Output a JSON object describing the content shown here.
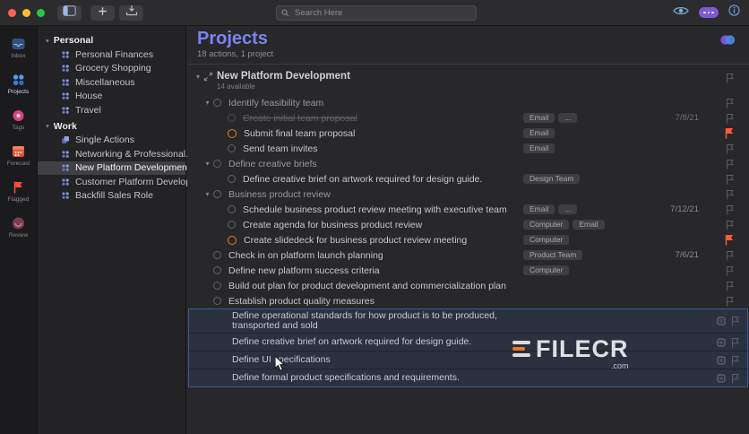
{
  "toolbar": {
    "search_placeholder": "Search Here"
  },
  "rail": {
    "items": [
      {
        "id": "inbox",
        "label": "Inbox",
        "selected": false
      },
      {
        "id": "projects",
        "label": "Projects",
        "selected": true
      },
      {
        "id": "tags",
        "label": "Tags",
        "selected": false
      },
      {
        "id": "forecast",
        "label": "Forecast",
        "selected": false
      },
      {
        "id": "flagged",
        "label": "Flagged",
        "selected": false
      },
      {
        "id": "review",
        "label": "Review",
        "selected": false
      }
    ]
  },
  "sidebar": {
    "sections": [
      {
        "title": "Personal",
        "items": [
          {
            "label": "Personal Finances"
          },
          {
            "label": "Grocery Shopping"
          },
          {
            "label": "Miscellaneous"
          },
          {
            "label": "House"
          },
          {
            "label": "Travel"
          }
        ]
      },
      {
        "title": "Work",
        "items": [
          {
            "label": "Single Actions",
            "icon": "stack"
          },
          {
            "label": "Networking & Professional..."
          },
          {
            "label": "New Platform Development",
            "selected": true
          },
          {
            "label": "Customer Platform Develop..."
          },
          {
            "label": "Backfill Sales Role"
          }
        ]
      }
    ]
  },
  "main": {
    "title": "Projects",
    "subtitle": "18 actions, 1 project",
    "project": {
      "name": "New Platform Development",
      "available": "14 available"
    },
    "overflow_label": "...",
    "tasks": [
      {
        "type": "group",
        "indent": 1,
        "title": "Identify feasibility team",
        "tags": [],
        "date": "",
        "flag": "dim"
      },
      {
        "type": "task",
        "indent": 2,
        "state": "done",
        "title": "Create initial team proposal",
        "tags": [
          "Email"
        ],
        "more": true,
        "date": "7/8/21",
        "flag": "dim"
      },
      {
        "type": "task",
        "indent": 2,
        "state": "due",
        "title": "Submit final team proposal",
        "tags": [
          "Email"
        ],
        "date": "",
        "flag": "orange"
      },
      {
        "type": "task",
        "indent": 2,
        "title": "Send team invites",
        "tags": [
          "Email"
        ],
        "date": "",
        "flag": "dim"
      },
      {
        "type": "group",
        "indent": 1,
        "title": "Define creative briefs",
        "tags": [],
        "date": "",
        "flag": "dim"
      },
      {
        "type": "task",
        "indent": 2,
        "title": "Define creative brief on artwork required for design guide.",
        "tags": [
          "Design Team"
        ],
        "date": "",
        "flag": "dim"
      },
      {
        "type": "group",
        "indent": 1,
        "title": "Business product review",
        "tags": [],
        "date": "",
        "flag": "dim"
      },
      {
        "type": "task",
        "indent": 2,
        "title": "Schedule business product review meeting with executive team",
        "tags": [
          "Email"
        ],
        "more": true,
        "date": "7/12/21",
        "flag": "dim"
      },
      {
        "type": "task",
        "indent": 2,
        "title": "Create agenda for business product review",
        "tags": [
          "Computer",
          "Email"
        ],
        "date": "",
        "flag": "dim"
      },
      {
        "type": "task",
        "indent": 2,
        "state": "due",
        "title": "Create slidedeck for business product review meeting",
        "tags": [
          "Computer"
        ],
        "date": "",
        "flag": "orange"
      },
      {
        "type": "task",
        "indent": 1,
        "title": "Check in on platform launch planning",
        "tags": [
          "Product Team"
        ],
        "date": "7/6/21",
        "flag": "dim"
      },
      {
        "type": "task",
        "indent": 1,
        "title": "Define new platform success criteria",
        "tags": [
          "Computer"
        ],
        "date": "",
        "flag": "dim"
      },
      {
        "type": "task",
        "indent": 1,
        "title": "Build out plan for product development and commercialization plan",
        "tags": [],
        "date": "",
        "flag": "dim"
      },
      {
        "type": "task",
        "indent": 1,
        "title": "Establish product quality measures",
        "tags": [],
        "date": "",
        "flag": "dim"
      },
      {
        "type": "task",
        "indent": 1,
        "selected": true,
        "handle": true,
        "title": "Define operational standards for how product is to be produced, transported and sold",
        "tags": [],
        "date": "",
        "flag": "dim"
      },
      {
        "type": "task",
        "indent": 1,
        "selected": true,
        "handle": true,
        "title": "Define creative brief on artwork required for design guide.",
        "tags": [],
        "date": "",
        "flag": "dim"
      },
      {
        "type": "task",
        "indent": 1,
        "selected": true,
        "handle": true,
        "title": "Define UI specifications",
        "tags": [],
        "date": "",
        "flag": "dim"
      },
      {
        "type": "task",
        "indent": 1,
        "selected": true,
        "handle": true,
        "title": "Define formal product specifications and requirements.",
        "tags": [],
        "date": "",
        "flag": "dim"
      }
    ]
  },
  "watermark": {
    "text": "FILECR",
    "suffix": ".com"
  }
}
